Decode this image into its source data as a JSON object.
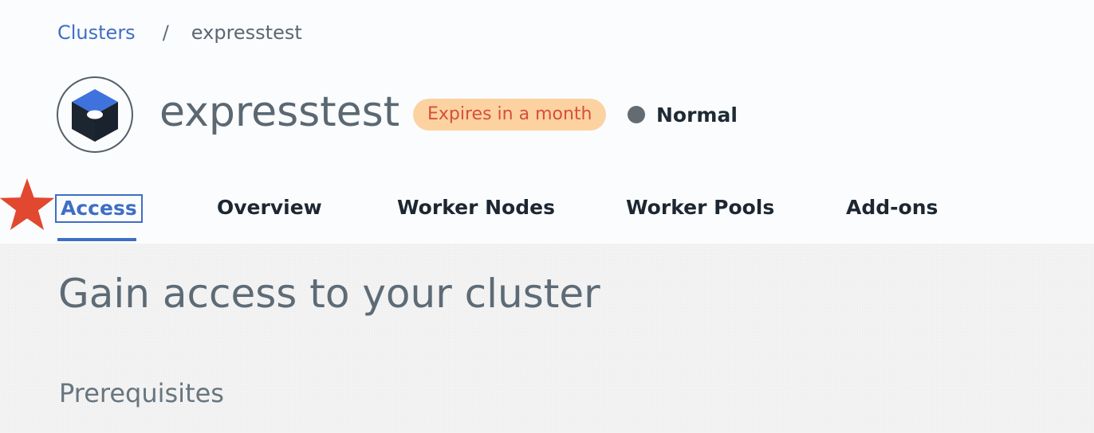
{
  "breadcrumb": {
    "parent_label": "Clusters",
    "separator": "/",
    "current_label": "expresstest"
  },
  "cluster": {
    "name": "expresstest",
    "expiry_badge": "Expires in a month",
    "status": "Normal"
  },
  "tabs": [
    {
      "label": "Access",
      "active": true
    },
    {
      "label": "Overview",
      "active": false
    },
    {
      "label": "Worker Nodes",
      "active": false
    },
    {
      "label": "Worker Pools",
      "active": false
    },
    {
      "label": "Add-ons",
      "active": false
    }
  ],
  "content": {
    "heading": "Gain access to your cluster",
    "section_heading": "Prerequisites"
  },
  "colors": {
    "accent": "#3e6ec5",
    "badge_background": "#fcd2a0",
    "badge_text": "#d4503a",
    "status_dot": "#626c72",
    "marker_star": "#e2472f"
  },
  "icons": {
    "cluster_logo": "kubernetes-cube-icon",
    "marker": "star-icon"
  }
}
